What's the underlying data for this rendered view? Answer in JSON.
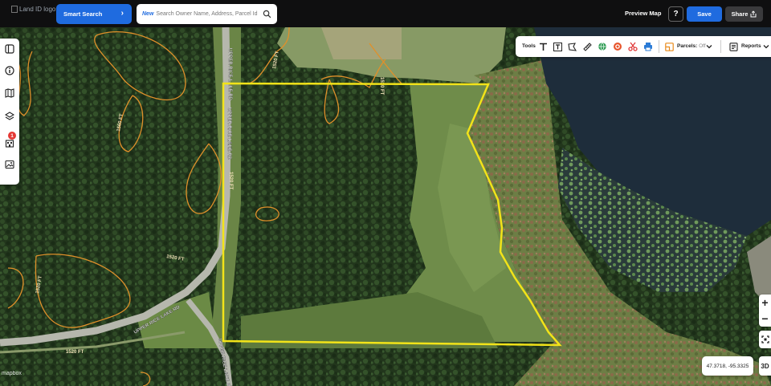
{
  "header": {
    "logo_alt": "Land ID logo",
    "smart_search_label": "Smart Search",
    "search_new_tag": "New",
    "search_placeholder": "Search Owner Name, Address, Parcel Id",
    "preview_map_label": "Preview Map",
    "help_label": "?",
    "save_label": "Save",
    "share_label": "Share"
  },
  "left_toolbar": {
    "items": [
      {
        "icon": "panel-toggle-icon"
      },
      {
        "icon": "info-icon"
      },
      {
        "icon": "map-book-icon"
      },
      {
        "icon": "layers-icon"
      },
      {
        "icon": "building-icon",
        "badge": "1"
      },
      {
        "icon": "image-icon"
      }
    ]
  },
  "right_toolbar": {
    "tools_label": "Tools",
    "tool_icons": [
      "text-tool-icon",
      "text-box-icon",
      "polygon-tool-icon",
      "ruler-icon",
      "globe-add-icon",
      "target-icon",
      "scissors-icon",
      "print-icon"
    ],
    "parcels_label": "Parcels:",
    "parcels_value": "Off",
    "reports_label": "Reports"
  },
  "map": {
    "road_labels": [
      "UPPER RICE LAKE RD",
      "UPPER RICE LAKE RD",
      "UPPER RICE LAKE RD",
      "UPPER RICE LAKE RD"
    ],
    "contour_labels": [
      "1520 FT",
      "1520 FT",
      "1520 FT",
      "1520 FT",
      "1520 FT",
      "1520 FT",
      "1560 FT"
    ],
    "parcel_outline_color": "#f2e319",
    "contour_color": "#e0902a"
  },
  "map_controls": {
    "zoom_in": "+",
    "zoom_out": "−",
    "coordinates": "47.3718, -95.3325",
    "three_d_label": "3D",
    "attribution": "mapbox"
  }
}
